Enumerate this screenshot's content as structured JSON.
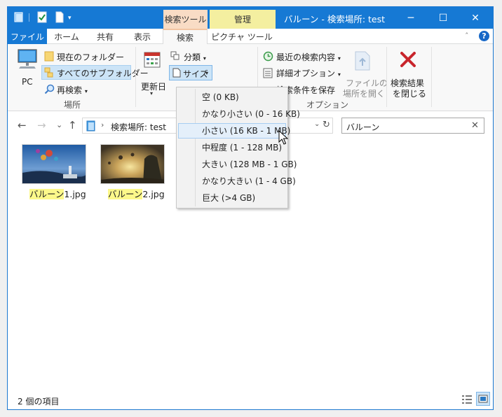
{
  "titlebar": {
    "context_search": "検索ツール",
    "context_manage": "管理",
    "title": "バルーン - 検索場所: test",
    "minimize": "─",
    "maximize": "☐",
    "close": "✕",
    "qa_caret": "▾"
  },
  "tabs": {
    "file": "ファイル",
    "home": "ホーム",
    "share": "共有",
    "view": "表示",
    "search": "検索",
    "picture": "ピクチャ ツール",
    "collapse": "ˆ",
    "help": "?"
  },
  "ribbon": {
    "pc": "PC",
    "current_folder": "現在のフォルダー",
    "all_subfolders": "すべてのサブフォルダー",
    "search_again": "再検索",
    "location_group": "場所",
    "modified": "更新日",
    "kind": "分類",
    "size": "サイズ",
    "recent_searches": "最近の検索内容",
    "advanced_options": "詳細オプション",
    "save_search": "検索条件を保存",
    "options_group": "オプション",
    "open_file_location_1": "ファイルの",
    "open_file_location_2": "場所を開く",
    "close_search_1": "検索結果",
    "close_search_2": "を閉じる",
    "caret": "▾"
  },
  "address": {
    "back": "←",
    "forward": "→",
    "recent": "⌄",
    "up": "↑",
    "separator": "›",
    "path": "検索場所: test",
    "dropdown": "⌄",
    "refresh": "↻"
  },
  "search": {
    "value": "バルーン",
    "clear": "✕"
  },
  "size_menu": {
    "items": [
      "空 (0 KB)",
      "かなり小さい (0 - 16 KB)",
      "小さい (16 KB - 1 MB)",
      "中程度 (1 - 128 MB)",
      "大きい (128 MB - 1 GB)",
      "かなり大きい (1 - 4 GB)",
      "巨大 (>4 GB)"
    ],
    "hovered_index": 2
  },
  "files": [
    {
      "name_match": "バルーン",
      "name_rest": "1.jpg"
    },
    {
      "name_match": "バルーン",
      "name_rest": "2.jpg"
    }
  ],
  "status": {
    "item_count": "2 個の項目"
  },
  "colors": {
    "accent": "#1679d4",
    "search_tools_tab": "#f9dcc5",
    "manage_tab": "#f4efa0",
    "highlight": "#fcf88a",
    "selection": "#cce4f7"
  }
}
